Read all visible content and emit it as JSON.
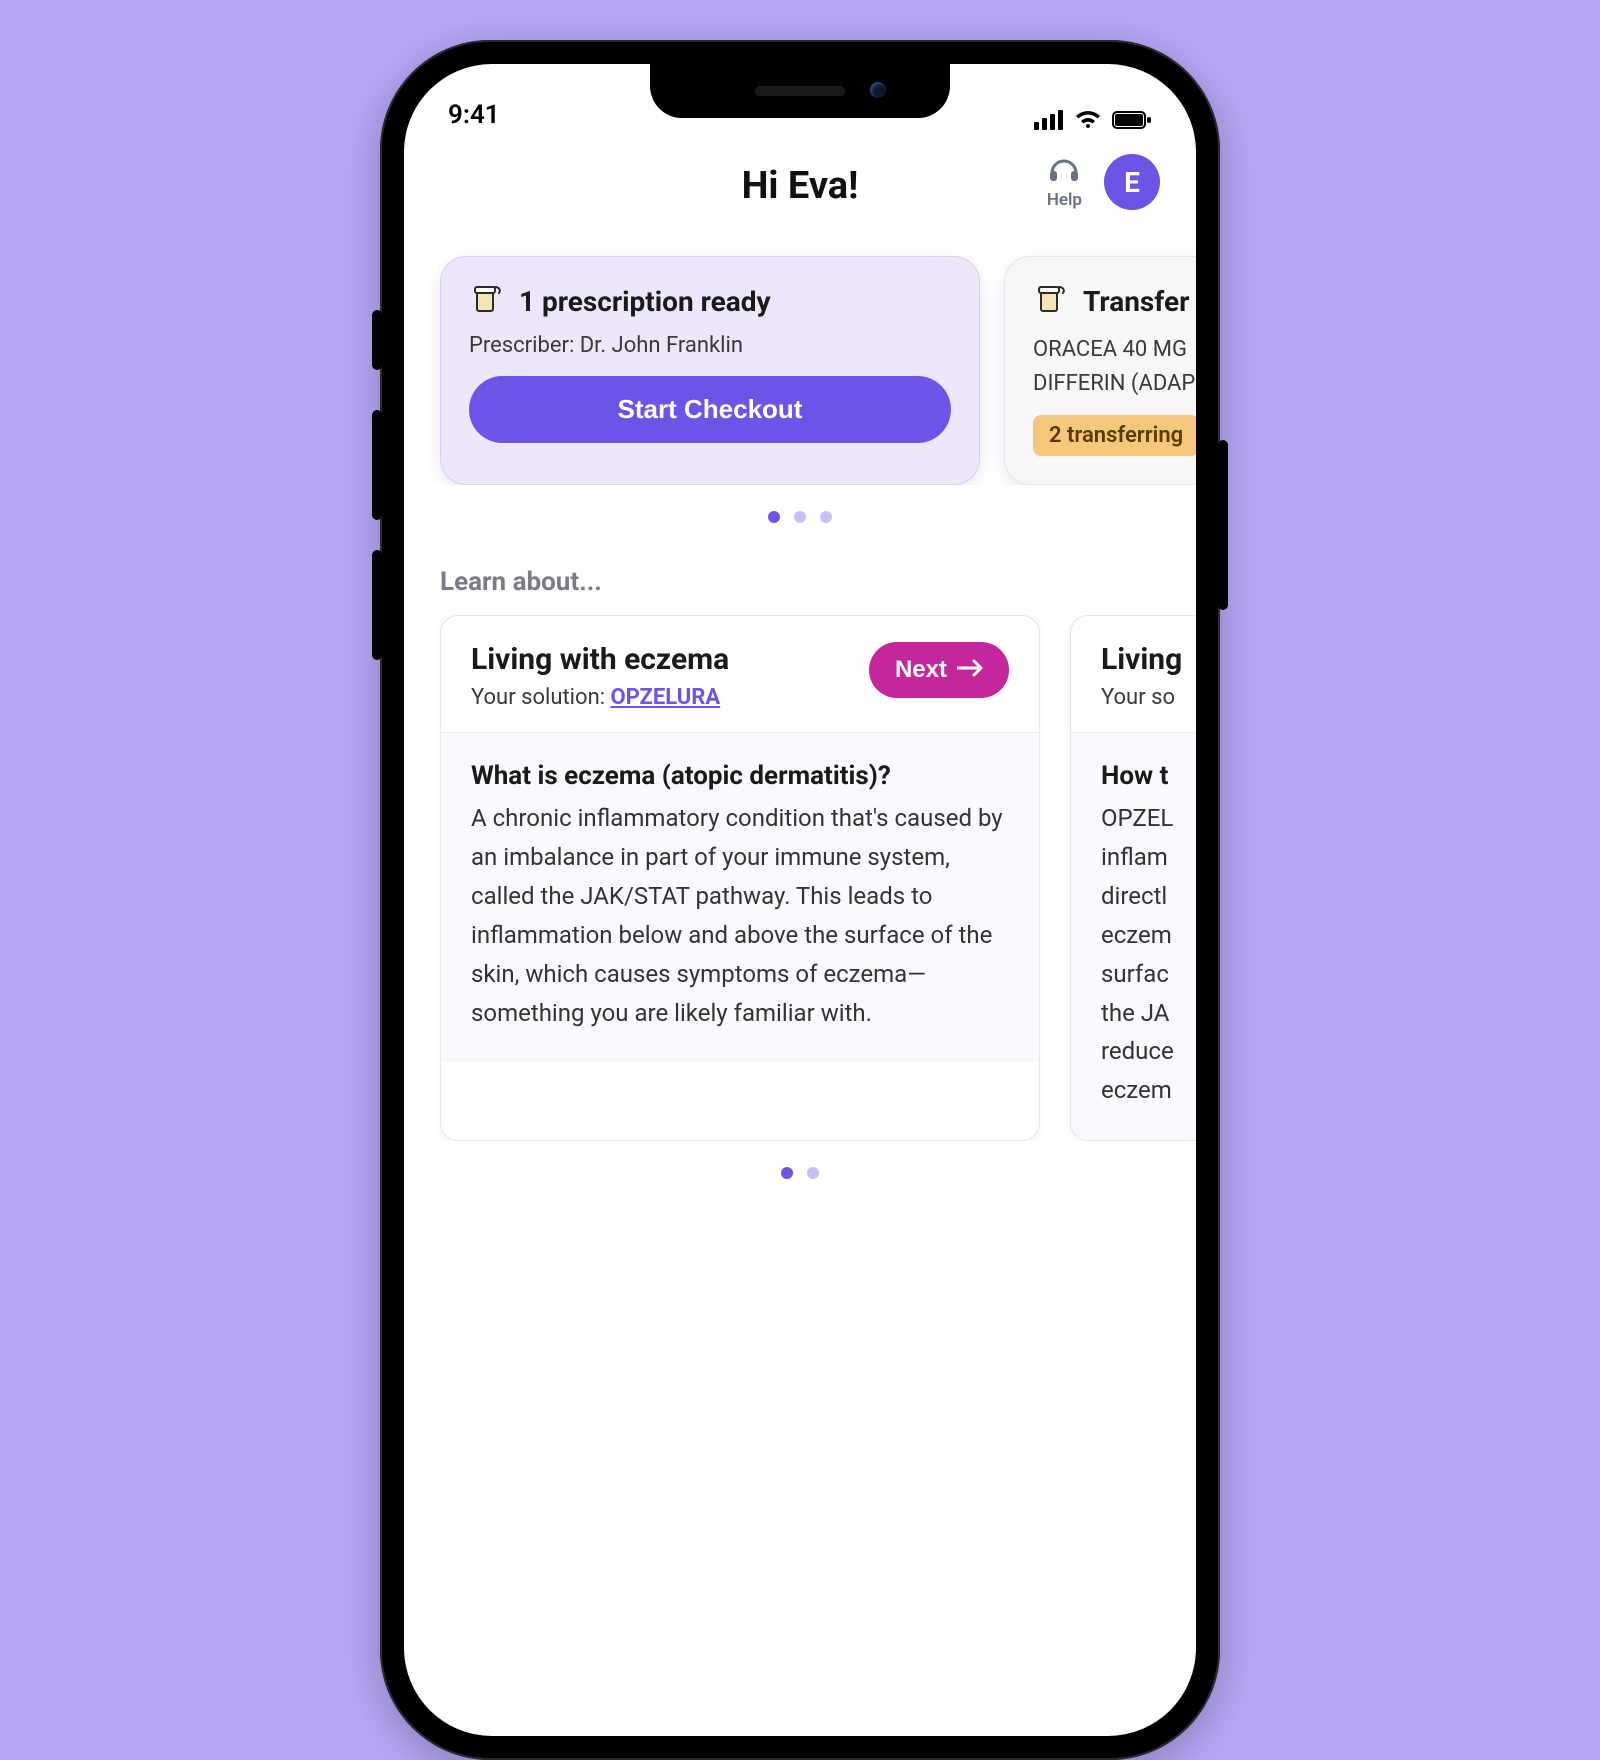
{
  "status": {
    "time": "9:41"
  },
  "header": {
    "greeting": "Hi Eva!",
    "help_label": "Help",
    "avatar_initial": "E"
  },
  "rx_carousel": {
    "dots": 3,
    "active_dot": 0,
    "cards": [
      {
        "title": "1 prescription ready",
        "subtitle": "Prescriber: Dr. John Franklin",
        "cta_label": "Start Checkout"
      },
      {
        "title": "Transfer",
        "line1": "ORACEA 40 MG",
        "line2": "DIFFERIN (ADAP",
        "badge": "2 transferring"
      }
    ]
  },
  "learn": {
    "section_label": "Learn about...",
    "dots": 2,
    "active_dot": 0,
    "cards": [
      {
        "title": "Living with eczema",
        "solution_prefix": "Your solution:  ",
        "solution_link": "OPZELURA",
        "next_label": "Next",
        "question": "What is eczema (atopic dermatitis)?",
        "answer": "A chronic inflammatory condition that's caused by an imbalance in part of your immune system, called the JAK/STAT pathway. This leads to inflammation below and above the surface of the skin, which causes symptoms of eczema—something you are likely familiar with."
      },
      {
        "title": "Living",
        "solution_prefix": "Your so",
        "solution_link": "",
        "next_label": "",
        "question": "How t",
        "answer": "OPZEL\ninflam\ndirectl\neczem\nsurfac\nthe JA\nreduce\neczem"
      }
    ]
  }
}
